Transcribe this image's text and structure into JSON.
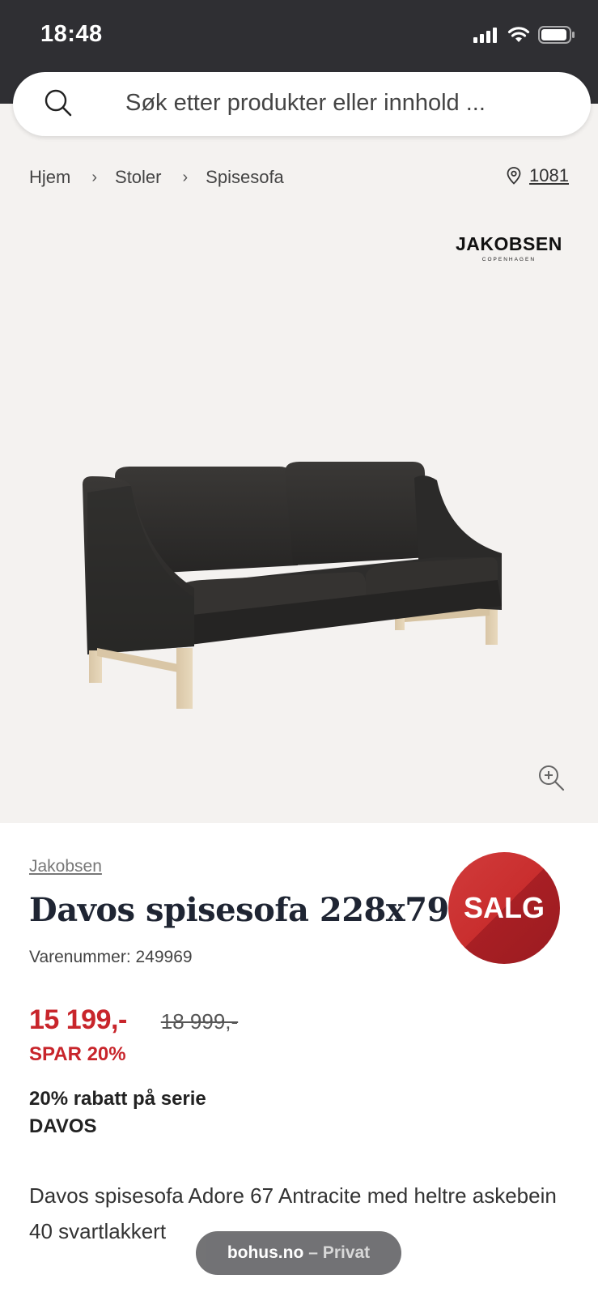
{
  "status_bar": {
    "time": "18:48"
  },
  "search": {
    "placeholder": "Søk etter produkter eller innhold ..."
  },
  "breadcrumb": {
    "items": [
      "Hjem",
      "Stoler",
      "Spisesofa"
    ]
  },
  "store": {
    "code": "1081"
  },
  "brand_logo": {
    "name": "JAKOBSEN",
    "tagline": "COPENHAGEN"
  },
  "product": {
    "brand": "Jakobsen",
    "title": "Davos spisesofa 228x79",
    "sku_label": "Varenummer: 249969",
    "sale_badge": "SALG",
    "price_now": "15 199,-",
    "price_old": "18 999,-",
    "save": "SPAR 20%",
    "promo": "20% rabatt på serie DAVOS",
    "description": "Davos spisesofa Adore 67 Antracite med heltre askebein 40 svartlakkert"
  },
  "browser": {
    "domain": "bohus.no",
    "mode": "– Privat"
  },
  "colors": {
    "status_bar": "#2f2f33",
    "hero_bg": "#f4f2f0",
    "sale_red": "#c8252b",
    "title_navy": "#1f2533"
  }
}
